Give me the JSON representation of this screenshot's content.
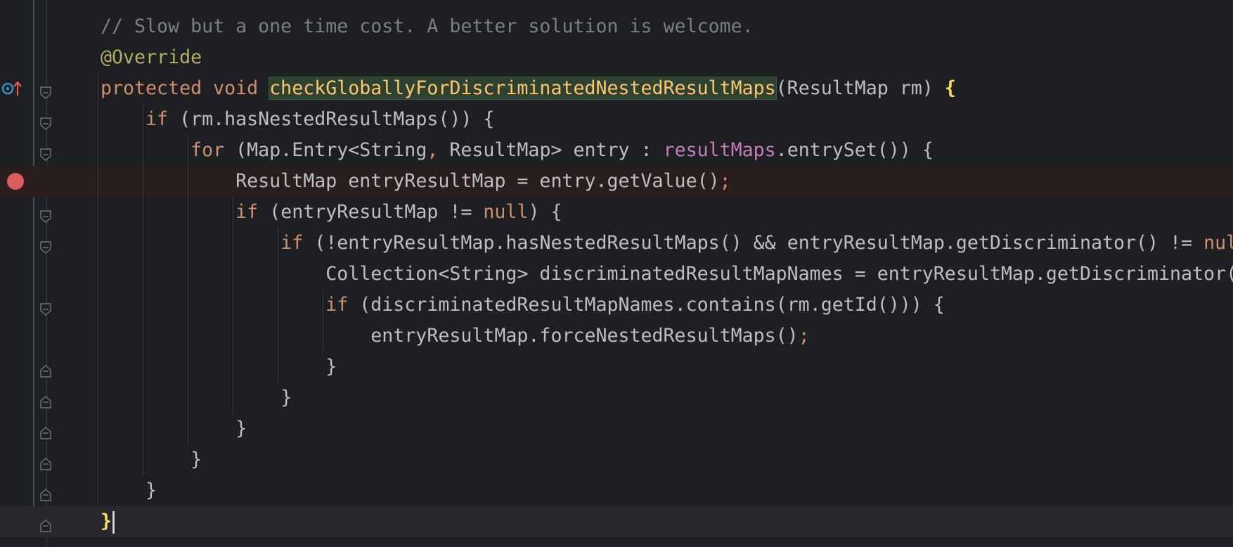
{
  "editor": {
    "breakpoint_line": 6,
    "caret_line": 17,
    "lines": [
      {
        "tokens": [
          {
            "t": "// Slow but a one time cost. A better solution is welcome.",
            "c": "cm"
          }
        ]
      },
      {
        "tokens": [
          {
            "t": "@Override",
            "c": "an"
          }
        ]
      },
      {
        "tokens": [
          {
            "t": "protected ",
            "c": "kw"
          },
          {
            "t": "void ",
            "c": "kw"
          },
          {
            "t": "checkGloballyForDiscriminatedNestedResultMaps",
            "c": "method-hl"
          },
          {
            "t": "(ResultMap rm) ",
            "c": ""
          },
          {
            "t": "{",
            "c": "brace-hl"
          }
        ]
      },
      {
        "tokens": [
          {
            "t": "    "
          },
          {
            "t": "if ",
            "c": "kw"
          },
          {
            "t": "(rm.hasNestedResultMaps()) {",
            "c": ""
          }
        ]
      },
      {
        "tokens": [
          {
            "t": "        "
          },
          {
            "t": "for ",
            "c": "kw"
          },
          {
            "t": "(Map.Entry<String",
            "c": ""
          },
          {
            "t": ", ",
            "c": "sem"
          },
          {
            "t": "ResultMap> entry : ",
            "c": ""
          },
          {
            "t": "resultMaps",
            "c": "fld"
          },
          {
            "t": ".entrySet()) {",
            "c": ""
          }
        ]
      },
      {
        "tokens": [
          {
            "t": "            "
          },
          {
            "t": "ResultMap entryResultMap = entry.getValue()",
            "c": ""
          },
          {
            "t": ";",
            "c": "sem"
          }
        ]
      },
      {
        "tokens": [
          {
            "t": "            "
          },
          {
            "t": "if ",
            "c": "kw"
          },
          {
            "t": "(entryResultMap != ",
            "c": ""
          },
          {
            "t": "null",
            "c": "kw"
          },
          {
            "t": ") {",
            "c": ""
          }
        ]
      },
      {
        "tokens": [
          {
            "t": "                "
          },
          {
            "t": "if ",
            "c": "kw"
          },
          {
            "t": "(!entryResultMap.hasNestedResultMaps() && entryResultMap.getDiscriminator() != ",
            "c": ""
          },
          {
            "t": "null",
            "c": "kw"
          }
        ]
      },
      {
        "tokens": [
          {
            "t": "                    "
          },
          {
            "t": "Collection<String> discriminatedResultMapNames = entryResultMap.getDiscriminator(",
            "c": ""
          }
        ]
      },
      {
        "tokens": [
          {
            "t": "                    "
          },
          {
            "t": "if ",
            "c": "kw"
          },
          {
            "t": "(discriminatedResultMapNames.contains(rm.getId())) {",
            "c": ""
          }
        ]
      },
      {
        "tokens": [
          {
            "t": "                        "
          },
          {
            "t": "entryResultMap.forceNestedResultMaps()",
            "c": ""
          },
          {
            "t": ";",
            "c": "sem"
          }
        ]
      },
      {
        "tokens": [
          {
            "t": "                    "
          },
          {
            "t": "}",
            "c": ""
          }
        ]
      },
      {
        "tokens": [
          {
            "t": "                "
          },
          {
            "t": "}",
            "c": ""
          }
        ]
      },
      {
        "tokens": [
          {
            "t": "            "
          },
          {
            "t": "}",
            "c": ""
          }
        ]
      },
      {
        "tokens": [
          {
            "t": "        "
          },
          {
            "t": "}",
            "c": ""
          }
        ]
      },
      {
        "tokens": [
          {
            "t": "    "
          },
          {
            "t": "}",
            "c": ""
          }
        ]
      },
      {
        "tokens": [
          {
            "t": "}",
            "c": "brace-hl"
          }
        ],
        "caret": true
      }
    ],
    "fold_markers": {
      "open": [
        2,
        3,
        4,
        6,
        7,
        9
      ],
      "close": [
        11,
        12,
        13,
        14,
        15,
        16
      ]
    },
    "gutter_icons": {
      "override_line": 2,
      "override_icon": "override-method-icon",
      "breakpoint_icon": "breakpoint-icon"
    },
    "colors": {
      "background": "#1e1f22",
      "keyword": "#cf8e6d",
      "comment": "#7a7e85",
      "annotation": "#b3ae60",
      "field": "#c77dbb",
      "default_text": "#bcbec4",
      "highlighted_brace": "#fede5d",
      "breakpoint": "#db5c5c",
      "breakpoint_line_bg": "#2a1d1e",
      "method_highlight_bg": "#2e4232"
    }
  }
}
